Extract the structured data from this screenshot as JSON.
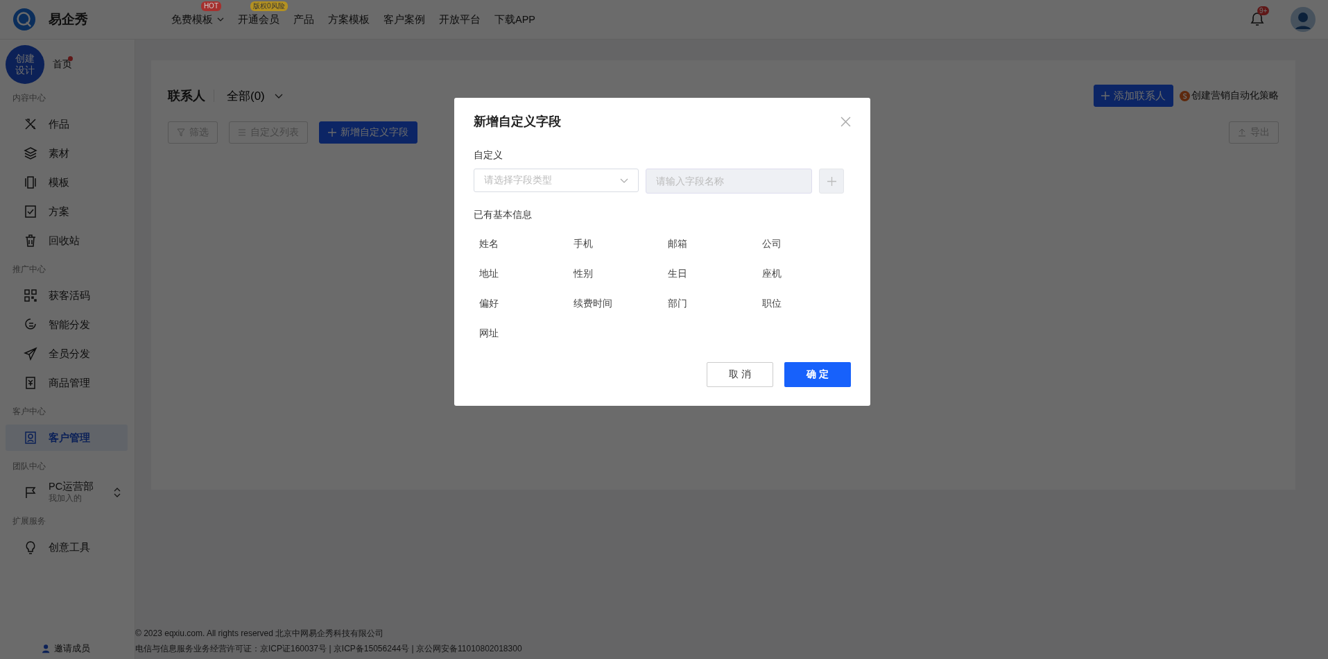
{
  "header": {
    "logo_text": "易企秀",
    "nav": [
      {
        "label": "免费模板",
        "badge": {
          "text": "HOT",
          "color": "#a5302e"
        },
        "dropdown": true
      },
      {
        "label": "开通会员",
        "badge": {
          "text": "版权0风险",
          "color": "#b39122"
        },
        "dropdown": false
      },
      {
        "label": "产品",
        "dropdown": false
      },
      {
        "label": "方案模板",
        "dropdown": false
      },
      {
        "label": "客户案例",
        "dropdown": false
      },
      {
        "label": "开放平台",
        "dropdown": false
      },
      {
        "label": "下载APP",
        "dropdown": false
      }
    ],
    "notification_count": "9+"
  },
  "sidebar": {
    "create_button": "创建设计",
    "home": {
      "label": "首页",
      "dot": true
    },
    "sections": [
      {
        "title": "内容中心",
        "items": [
          {
            "label": "作品",
            "selected": false
          },
          {
            "label": "素材",
            "selected": false
          },
          {
            "label": "模板",
            "selected": false
          },
          {
            "label": "方案",
            "selected": false
          },
          {
            "label": "回收站",
            "selected": false
          }
        ]
      },
      {
        "title": "推广中心",
        "items": [
          {
            "label": "获客活码",
            "selected": false
          },
          {
            "label": "智能分发",
            "selected": false
          },
          {
            "label": "全员分发",
            "selected": false
          },
          {
            "label": "商品管理",
            "selected": false
          }
        ]
      },
      {
        "title": "客户中心",
        "items": [
          {
            "label": "客户管理",
            "selected": true
          }
        ]
      },
      {
        "title": "团队中心",
        "items": [
          {
            "label": "PC运营部",
            "sublabel": "我加入的",
            "selected": false
          }
        ]
      },
      {
        "title": "扩展服务",
        "items": [
          {
            "label": "创意工具",
            "selected": false
          }
        ]
      }
    ],
    "invite": "邀请成员"
  },
  "main": {
    "title": "联系人",
    "filter": "全部(0)",
    "add_button": "添加联系人",
    "strategy_link": "创建营销自动化策略",
    "toolbar": [
      {
        "label": "筛选",
        "disabled": true
      },
      {
        "label": "自定义列表",
        "disabled": true
      },
      {
        "label": "新增自定义字段",
        "disabled": false
      }
    ],
    "export_button": {
      "label": "导出",
      "disabled": true
    }
  },
  "footer": [
    "© 2023 eqxiu.com. All rights reserved 北京中网易企秀科技有限公司",
    "电信与信息服务业务经营许可证：京ICP证160037号 | 京ICP备15056244号 | 京公网安备11010802018300"
  ],
  "dialog": {
    "title": "新增自定义字段",
    "custom_label": "自定义",
    "type_select": {
      "placeholder": "请选择字段类型"
    },
    "name_input": {
      "placeholder": "请输入字段名称",
      "disabled": true
    },
    "existing_label": "已有基本信息",
    "fields": [
      "姓名",
      "手机",
      "邮箱",
      "公司",
      "地址",
      "性别",
      "生日",
      "座机",
      "偏好",
      "续费时间",
      "部门",
      "职位",
      "网址"
    ],
    "cancel": "取 消",
    "confirm": "确 定"
  }
}
